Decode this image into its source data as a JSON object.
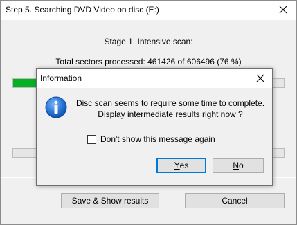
{
  "window": {
    "title": "Step 5. Searching DVD Video on disc (E:)",
    "stage_text": "Stage 1. Intensive scan:",
    "sectors_text": "Total sectors processed: 461426 of 606496 (76 %)",
    "progress_fraction": 0.76,
    "secondary_progress_fraction": 0,
    "buttons": {
      "save_show": "Save & Show results",
      "cancel": "Cancel"
    },
    "colors": {
      "progress": "#06b025"
    }
  },
  "dialog": {
    "title": "Information",
    "icon": "information-icon",
    "message_line1": "Disc scan seems to require some time to complete.",
    "message_line2": "Display intermediate results right now ?",
    "checkbox_label": "Don't show this message again",
    "checkbox_checked": false,
    "buttons": {
      "yes": {
        "mnemonic": "Y",
        "rest": "es"
      },
      "no": {
        "mnemonic": "N",
        "rest": "o"
      }
    },
    "colors": {
      "icon_blue": "#1c6fd1",
      "default_button_border": "#0078d7"
    }
  }
}
